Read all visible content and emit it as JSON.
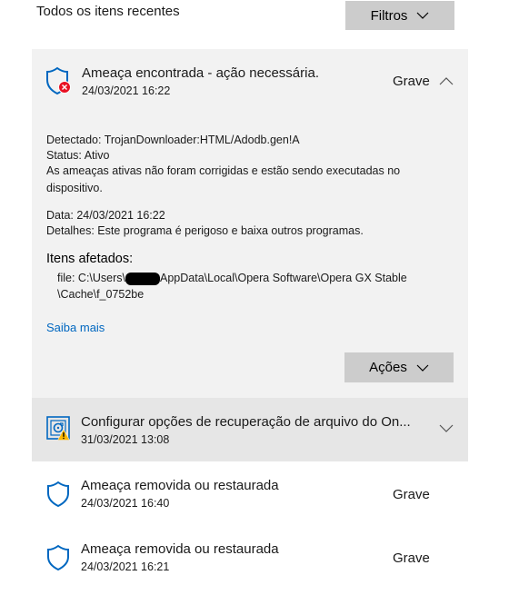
{
  "header": {
    "title": "Todos os itens recentes",
    "filter_label": "Filtros"
  },
  "expanded_threat": {
    "title": "Ameaça encontrada - ação necessária.",
    "date": "24/03/2021 16:22",
    "severity": "Grave",
    "detected_line": "Detectado:  TrojanDownloader:HTML/Adodb.gen!A",
    "status_line": "Status:  Ativo",
    "active_msg_1": "As ameaças ativas não foram corrigidas e estão sendo executadas no",
    "active_msg_2": "dispositivo.",
    "data_line": "Data:  24/03/2021 16:22",
    "details_line": "Detalhes:  Este programa é perigoso e baixa outros programas.",
    "affected_title": "Itens afetados:",
    "file_prefix": "file: C:\\Users\\",
    "file_path_rest": "AppData\\Local\\Opera Software\\Opera GX Stable",
    "file_path_line2": "\\Cache\\f_0752be",
    "learn_more": "Saiba mais",
    "actions_label": "Ações"
  },
  "recovery_item": {
    "title": "Configurar opções de recuperação de arquivo do On...",
    "date": "31/03/2021 13:08"
  },
  "items": [
    {
      "title": "Ameaça removida ou restaurada",
      "date": "24/03/2021 16:40",
      "severity": "Grave"
    },
    {
      "title": "Ameaça removida ou restaurada",
      "date": "24/03/2021 16:21",
      "severity": "Grave"
    }
  ],
  "colors": {
    "accent_link": "#0067c0",
    "shield_blue": "#0067c0",
    "alert_red": "#e81123",
    "warning_yellow": "#ffb900"
  },
  "icons": {
    "shield": "shield-icon",
    "error_badge": "error-badge-icon",
    "chevron_up": "chevron-up-icon",
    "chevron_down": "chevron-down-icon",
    "backup": "backup-settings-icon",
    "warning": "warning-icon"
  }
}
